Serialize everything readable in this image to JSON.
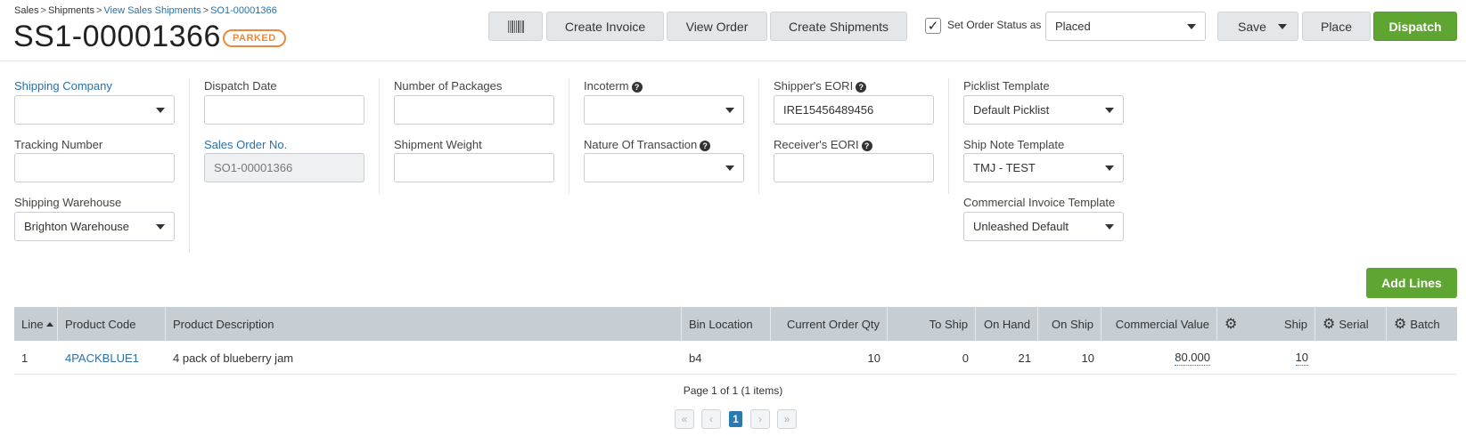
{
  "breadcrumb": {
    "items": [
      {
        "label": "Sales",
        "link": false
      },
      {
        "label": "Shipments",
        "link": false
      },
      {
        "label": "View Sales Shipments",
        "link": true
      },
      {
        "label": "SO1-00001366",
        "link": true
      }
    ],
    "separator": ">"
  },
  "header": {
    "title": "SS1-00001366",
    "status_badge": "PARKED"
  },
  "toolbar": {
    "barcode_icon": "barcode-icon",
    "create_invoice": "Create Invoice",
    "view_order": "View Order",
    "create_shipments": "Create Shipments",
    "set_order_status_checked": true,
    "set_order_status_label": "Set Order Status as",
    "order_status_value": "Placed",
    "save": "Save",
    "place": "Place",
    "dispatch": "Dispatch"
  },
  "form": {
    "shipping_company": {
      "label": "Shipping Company",
      "value": ""
    },
    "tracking_number": {
      "label": "Tracking Number",
      "value": ""
    },
    "shipping_warehouse": {
      "label": "Shipping Warehouse",
      "value": "Brighton Warehouse"
    },
    "dispatch_date": {
      "label": "Dispatch Date",
      "value": ""
    },
    "sales_order_no": {
      "label": "Sales Order No.",
      "value": "SO1-00001366"
    },
    "number_of_packages": {
      "label": "Number of Packages",
      "value": ""
    },
    "shipment_weight": {
      "label": "Shipment Weight",
      "value": ""
    },
    "incoterm": {
      "label": "Incoterm",
      "value": ""
    },
    "nature_of_transaction": {
      "label": "Nature Of Transaction",
      "value": ""
    },
    "shippers_eori": {
      "label": "Shipper's EORI",
      "value": "IRE15456489456"
    },
    "receivers_eori": {
      "label": "Receiver's EORI",
      "value": ""
    },
    "picklist_template": {
      "label": "Picklist Template",
      "value": "Default Picklist"
    },
    "ship_note_template": {
      "label": "Ship Note Template",
      "value": "TMJ - TEST"
    },
    "commercial_invoice_template": {
      "label": "Commercial Invoice Template",
      "value": "Unleashed Default"
    }
  },
  "lines": {
    "add_lines": "Add Lines",
    "columns": {
      "line": "Line",
      "product_code": "Product Code",
      "product_description": "Product Description",
      "bin_location": "Bin Location",
      "current_order_qty": "Current Order Qty",
      "to_ship": "To Ship",
      "on_hand": "On Hand",
      "on_ship": "On Ship",
      "commercial_value": "Commercial Value",
      "ship": "Ship",
      "serial": "Serial",
      "batch": "Batch"
    },
    "rows": [
      {
        "line": "1",
        "product_code": "4PACKBLUE1",
        "product_description": "4 pack of blueberry jam",
        "bin_location": "b4",
        "current_order_qty": "10",
        "to_ship": "0",
        "on_hand": "21",
        "on_ship": "10",
        "commercial_value": "80.000",
        "ship": "10",
        "serial": "",
        "batch": ""
      }
    ]
  },
  "pager": {
    "summary": "Page 1 of 1 (1 items)",
    "current_page": "1",
    "first": "«",
    "prev": "‹",
    "next": "›",
    "last": "»"
  },
  "colors": {
    "accent_green": "#5fa532",
    "link_blue": "#2a6fa8",
    "badge_orange": "#e98a3c",
    "header_grey": "#c6cdd3"
  }
}
